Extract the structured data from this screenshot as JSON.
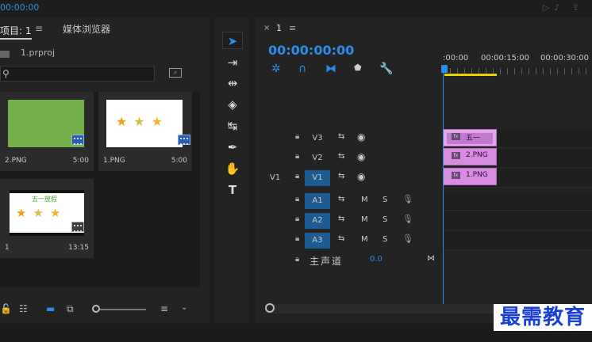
{
  "monitor": {
    "timecode": "00:00:00"
  },
  "project": {
    "tab_label": "项目: 1",
    "media_browser_label": "媒体浏览器",
    "file_name": "1.prproj",
    "search": {
      "value": "",
      "placeholder": ""
    },
    "items": [
      {
        "name": "2.PNG",
        "duration": "5:00",
        "thumb": "green"
      },
      {
        "name": "1.PNG",
        "duration": "5:00",
        "thumb": "stars"
      },
      {
        "name": "1",
        "duration": "13:15",
        "thumb": "title",
        "thumb_text": "五一放假"
      }
    ]
  },
  "timeline": {
    "sequence_name": "1",
    "timecode": "00:00:00:00",
    "ruler_labels": [
      ":00:00",
      "00:00:15:00",
      "00:00:30:00"
    ],
    "tracks": [
      {
        "name": "V3",
        "source": "",
        "kind": "video",
        "selected": false
      },
      {
        "name": "V2",
        "source": "",
        "kind": "video",
        "selected": false
      },
      {
        "name": "V1",
        "source": "V1",
        "kind": "video",
        "selected": true
      },
      {
        "name": "A1",
        "source": "",
        "kind": "audio",
        "selected": true
      },
      {
        "name": "A2",
        "source": "",
        "kind": "audio",
        "selected": true
      },
      {
        "name": "A3",
        "source": "",
        "kind": "audio",
        "selected": true
      }
    ],
    "clips": [
      {
        "track": "V3",
        "name": "五一",
        "type": "title"
      },
      {
        "track": "V2",
        "name": "2.PNG",
        "type": "image"
      },
      {
        "track": "V1",
        "name": "1.PNG",
        "type": "image"
      }
    ],
    "master": {
      "name": "主声道",
      "value": "0.0"
    },
    "buttons": {
      "mute": "M",
      "solo": "S"
    }
  },
  "watermark": "最需教育",
  "colors": {
    "accent": "#2d8ceb",
    "clip": "#d78ce0",
    "workarea": "#e6d500",
    "thumb_green": "#74b04a"
  }
}
